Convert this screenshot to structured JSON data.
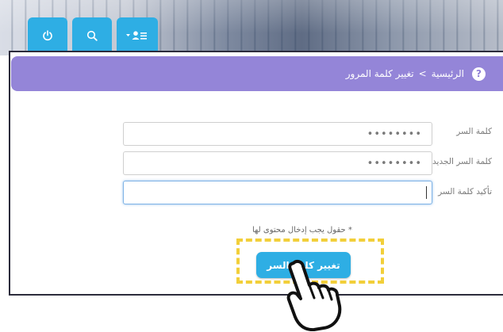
{
  "toolbar": {
    "tabs": [
      {
        "icon": "power-icon"
      },
      {
        "icon": "search-icon"
      },
      {
        "icon": "user-menu-icon"
      }
    ],
    "accent_color": "#2eaee4"
  },
  "breadcrumb": {
    "home": "الرئيسية",
    "separator": ">",
    "current": "تغيير كلمة المرور",
    "background_color": "#9485d8"
  },
  "form": {
    "password_label": "كلمة السر",
    "password_value": "••••••••",
    "new_password_label": "كلمة السر الجديدة",
    "new_password_value": "••••••••",
    "confirm_label": "تأكيد كلمة السر",
    "confirm_value": "",
    "required_note": "* حقول يجب إدخال محتوى لها",
    "submit_label": "تغيير كلمة السر"
  }
}
